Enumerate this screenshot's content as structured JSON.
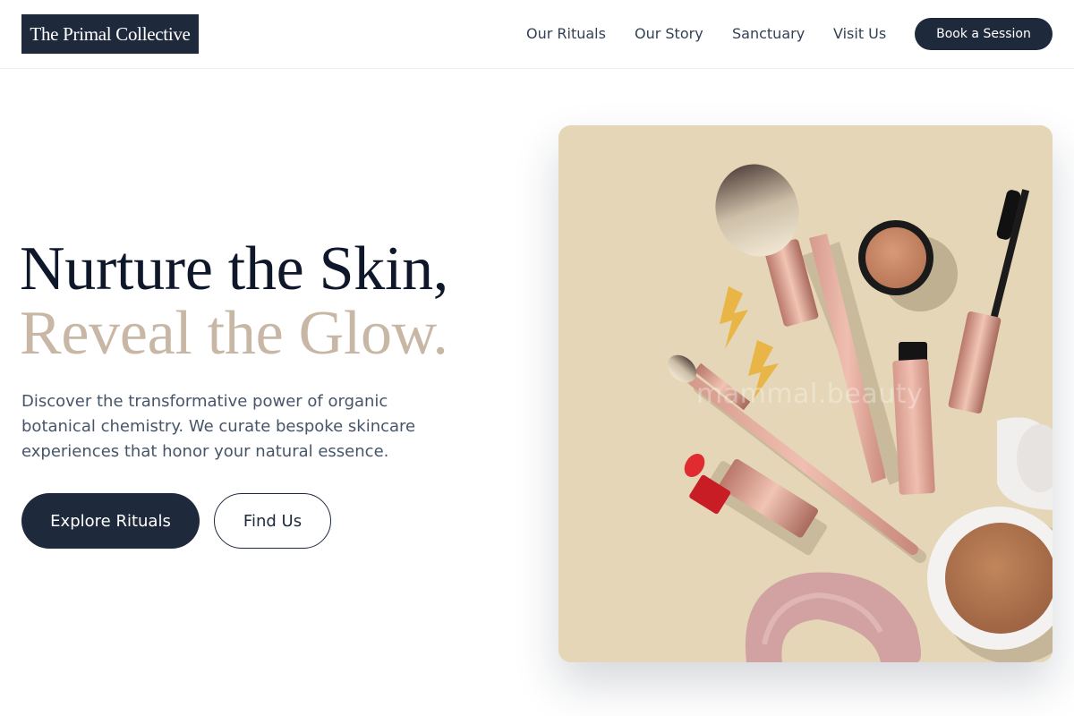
{
  "header": {
    "logo_text": "The Primal Collective",
    "nav": [
      {
        "label": "Our Rituals"
      },
      {
        "label": "Our Story"
      },
      {
        "label": "Sanctuary"
      },
      {
        "label": "Visit Us"
      }
    ],
    "cta_label": "Book a Session"
  },
  "hero": {
    "headline_line1": "Nurture the Skin,",
    "headline_line2": "Reveal the Glow.",
    "description": "Discover the transformative power of organic botanical chemistry. We curate bespoke skincare experiences that honor your natural essence.",
    "primary_button": "Explore Rituals",
    "secondary_button": "Find Us",
    "image": {
      "subject": "flat-lay of makeup brushes, mascara, lipstick, compact powder, blush pot, scrunchie and lightning earrings on beige background",
      "watermark": "mammal.beauty"
    }
  },
  "colors": {
    "navy": "#1e293b",
    "accent_beige": "#c9b7a6",
    "image_background": "#e4d6b6",
    "text_muted": "#475569"
  }
}
